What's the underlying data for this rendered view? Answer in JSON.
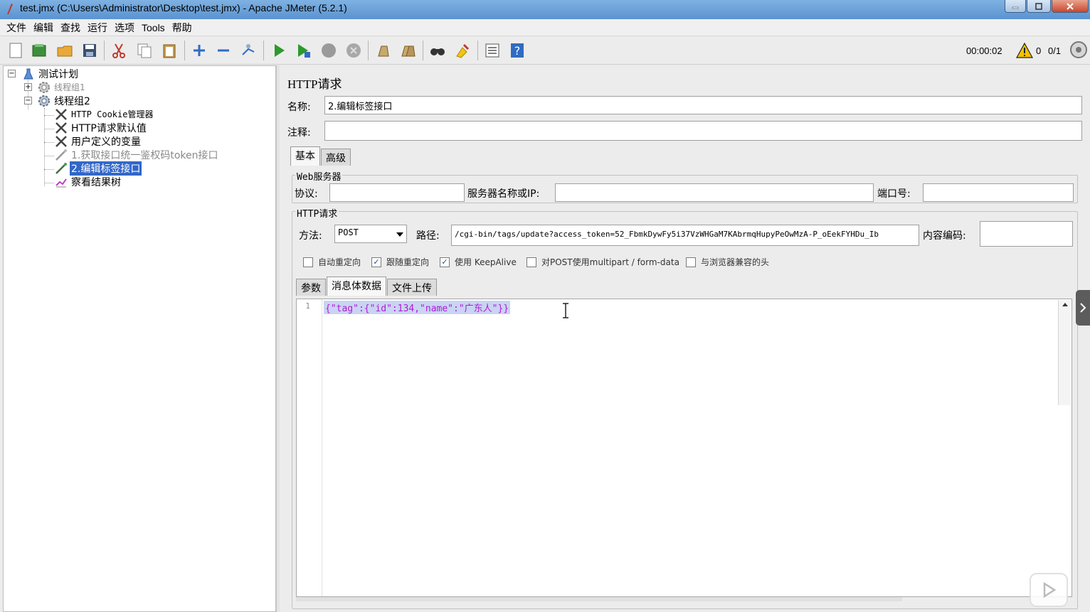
{
  "window": {
    "title": "test.jmx (C:\\Users\\Administrator\\Desktop\\test.jmx) - Apache JMeter (5.2.1)"
  },
  "menu": [
    "文件",
    "编辑",
    "查找",
    "运行",
    "选项",
    "Tools",
    "帮助"
  ],
  "toolbar": {
    "icons": [
      "new-icon",
      "templates-icon",
      "open-icon",
      "save-icon",
      "cut-icon",
      "copy-icon",
      "paste-icon",
      "expand-icon",
      "collapse-icon",
      "toggle-icon",
      "start-icon",
      "start-no-pause-icon",
      "stop-icon",
      "shutdown-icon",
      "clear-icon",
      "clear-all-icon",
      "search-icon",
      "reset-search-icon",
      "function-helper-icon",
      "help-icon"
    ],
    "timer": "00:00:02",
    "warning_count": "0",
    "threads": "0/1"
  },
  "tree": {
    "root": "测试计划",
    "items": [
      {
        "label": "线程组1",
        "disabled": true
      },
      {
        "label": "线程组2",
        "disabled": false
      },
      {
        "label": "HTTP Cookie管理器"
      },
      {
        "label": "HTTP请求默认值"
      },
      {
        "label": "用户定义的变量"
      },
      {
        "label": "1.获取接口统一鉴权码token接口",
        "disabled": true
      },
      {
        "label": "2.编辑标签接口",
        "selected": true
      },
      {
        "label": "察看结果树"
      }
    ]
  },
  "panel": {
    "title": "HTTP请求",
    "name_label": "名称:",
    "name_value": "2.编辑标签接口",
    "comment_label": "注释:",
    "comment_value": "",
    "tabs": [
      "基本",
      "高级"
    ],
    "web_server": {
      "group_title": "Web服务器",
      "protocol_label": "协议:",
      "protocol_value": "",
      "server_label": "服务器名称或IP:",
      "server_value": "",
      "port_label": "端口号:",
      "port_value": ""
    },
    "http_request": {
      "group_title": "HTTP请求",
      "method_label": "方法:",
      "method_value": "POST",
      "path_label": "路径:",
      "path_value": "/cgi-bin/tags/update?access_token=52_FbmkDywFy5i37VzWHGaM7KAbrmqHupyPeOwMzA-P_oEekFYHDu_Ib",
      "encoding_label": "内容编码:",
      "encoding_value": ""
    },
    "checkboxes": [
      {
        "label": "自动重定向",
        "checked": false
      },
      {
        "label": "跟随重定向",
        "checked": true
      },
      {
        "label": "使用 KeepAlive",
        "checked": true
      },
      {
        "label": "对POST使用multipart / form-data",
        "checked": false
      },
      {
        "label": "与浏览器兼容的头",
        "checked": false
      }
    ],
    "body_tabs": [
      "参数",
      "消息体数据",
      "文件上传"
    ],
    "body_line_number": "1",
    "body_text": "{\"tag\":{\"id\":134,\"name\":\"广东人\"}}"
  },
  "colors": {
    "selection": "#3267c8",
    "code_text": "#b21bd6",
    "code_highlight": "#c9d4f3"
  }
}
